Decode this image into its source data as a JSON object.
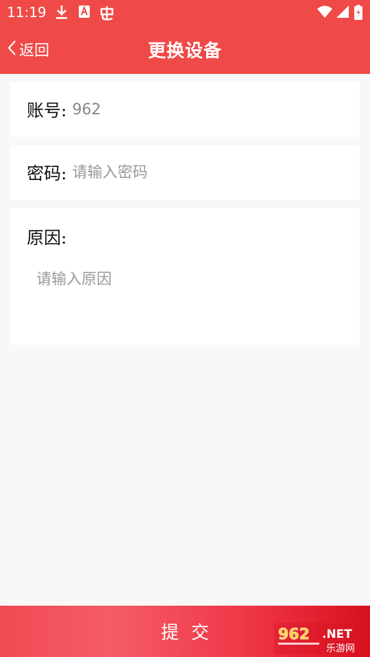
{
  "status_bar": {
    "time": "11:19",
    "icons": [
      "download-icon",
      "app-a-icon",
      "bug-icon",
      "wifi-icon",
      "signal-icon",
      "battery-icon"
    ]
  },
  "header": {
    "back_label": "返回",
    "title": "更换设备"
  },
  "form": {
    "account": {
      "label": "账号:",
      "value": "962"
    },
    "password": {
      "label": "密码:",
      "placeholder": "请输入密码"
    },
    "reason": {
      "label": "原因:",
      "placeholder": "请输入原因"
    }
  },
  "submit": {
    "label": "提交"
  },
  "watermark": {
    "brand": "962",
    "suffix": ".NET",
    "tagline": "乐游网"
  },
  "colors": {
    "accent": "#ef4a47",
    "submit_end": "#d8101f"
  }
}
